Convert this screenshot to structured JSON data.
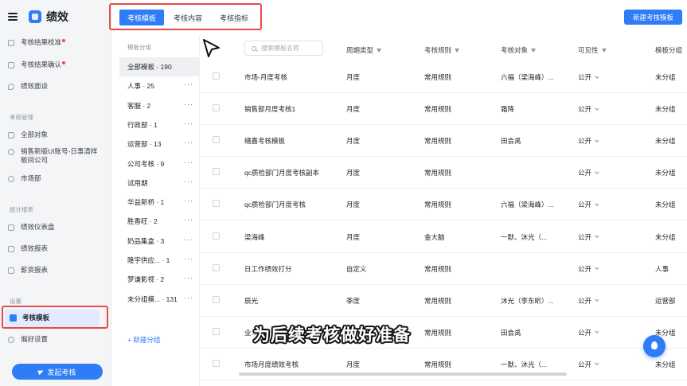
{
  "app": {
    "title": "绩效"
  },
  "sidebar": {
    "items_top": [
      {
        "label": "考核结果校准",
        "badge": true
      },
      {
        "label": "考核结果确认",
        "badge": true
      },
      {
        "label": "绩效面谈",
        "badge": false
      }
    ],
    "section_manage": "考核管理",
    "items_manage": [
      {
        "label": "全部对象"
      },
      {
        "label": "销售新版UI账号-日事清样板间公司"
      },
      {
        "label": "市场部"
      }
    ],
    "section_report": "统计报表",
    "items_report": [
      {
        "label": "绩效仪表盘"
      },
      {
        "label": "绩效报表"
      },
      {
        "label": "薪资报表"
      }
    ],
    "section_settings": "设置",
    "items_settings": [
      {
        "label": "考核模板",
        "active": true
      },
      {
        "label": "偏好设置"
      }
    ],
    "start_button": "发起考核"
  },
  "tabs": [
    {
      "label": "考核模板",
      "active": true
    },
    {
      "label": "考核内容",
      "active": false
    },
    {
      "label": "考核指标",
      "active": false
    }
  ],
  "new_template_button": "新建考核模板",
  "groups": {
    "title": "模板分组",
    "items": [
      {
        "label": "全部模板 · 190",
        "active": true
      },
      {
        "label": "人事 · 25"
      },
      {
        "label": "客服 · 2"
      },
      {
        "label": "行政部 · 1"
      },
      {
        "label": "运营部 · 13"
      },
      {
        "label": "公司考核 · 9"
      },
      {
        "label": "试用期"
      },
      {
        "label": "华益新桥 · 1"
      },
      {
        "label": "胜香旺 · 2"
      },
      {
        "label": "奶品集盒 · 3"
      },
      {
        "label": "隆宇供应... · 1"
      },
      {
        "label": "梦谦影视 · 2"
      },
      {
        "label": "未分组模... · 131"
      }
    ],
    "add_label": "+ 新建分组"
  },
  "table": {
    "search_placeholder": "搜索模板名称",
    "columns": [
      "周期类型",
      "考核规则",
      "考核对象",
      "可见性",
      "模板分组"
    ],
    "rows": [
      [
        "市场-月度考核",
        "月度",
        "常用规则",
        "六福（梁海峰）...",
        "公开",
        "未分组"
      ],
      [
        "销售部月度考核1",
        "月度",
        "常用规则",
        "霜降",
        "公开",
        "未分组"
      ],
      [
        "缙嘉考核模板",
        "月度",
        "常用规则",
        "田会禹",
        "公开",
        "未分组"
      ],
      [
        "qc质检部门月度考核副本",
        "月度",
        "常用规则",
        "",
        "公开",
        "未分组"
      ],
      [
        "qc质检部门月度考核",
        "月度",
        "常用规则",
        "六福（梁海峰）...",
        "公开",
        "未分组"
      ],
      [
        "梁海峰",
        "月度",
        "金大脑",
        "一默、沐光（...",
        "公开",
        "未分组"
      ],
      [
        "日工作绩效打分",
        "自定义",
        "常用规则",
        "",
        "公开",
        "人事"
      ],
      [
        "辰光",
        "季度",
        "常用规则",
        "沐光（李东昕）...",
        "公开",
        "运营部"
      ],
      [
        "业...",
        "",
        "常用规则",
        "田会禹",
        "公开",
        "未分组"
      ],
      [
        "市场月度绩效考核",
        "月度",
        "常用规则",
        "一默、沐光（...",
        "公开",
        "未分组"
      ]
    ]
  },
  "subtitle": "为后续考核做好准备"
}
